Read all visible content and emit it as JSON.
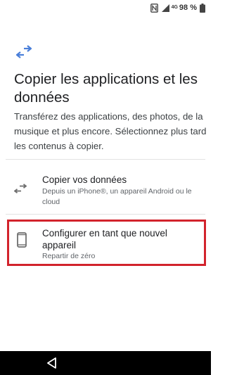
{
  "status_bar": {
    "network_label": "4G",
    "battery_text": "98 %"
  },
  "header": {
    "icon": "swap-arrows-icon",
    "title": "Copier les applications et les données",
    "subtitle": "Transférez des applications, des photos, de la musique et plus encore. Sélectionnez plus tard les contenus à copier."
  },
  "options": [
    {
      "icon": "swap-arrows-icon",
      "title": "Copier vos données",
      "subtitle": "Depuis un iPhone®, un appareil Android ou le cloud"
    },
    {
      "icon": "phone-icon",
      "title": "Configurer en tant que nouvel appareil",
      "subtitle": "Repartir de zéro",
      "highlight_color": "#d2232c"
    }
  ],
  "nav_bar": {
    "back_icon": "back-triangle-icon"
  },
  "colors": {
    "accent": "#4a7fd9",
    "icon_gray": "#6f6f6f",
    "highlight": "#d2232c"
  }
}
